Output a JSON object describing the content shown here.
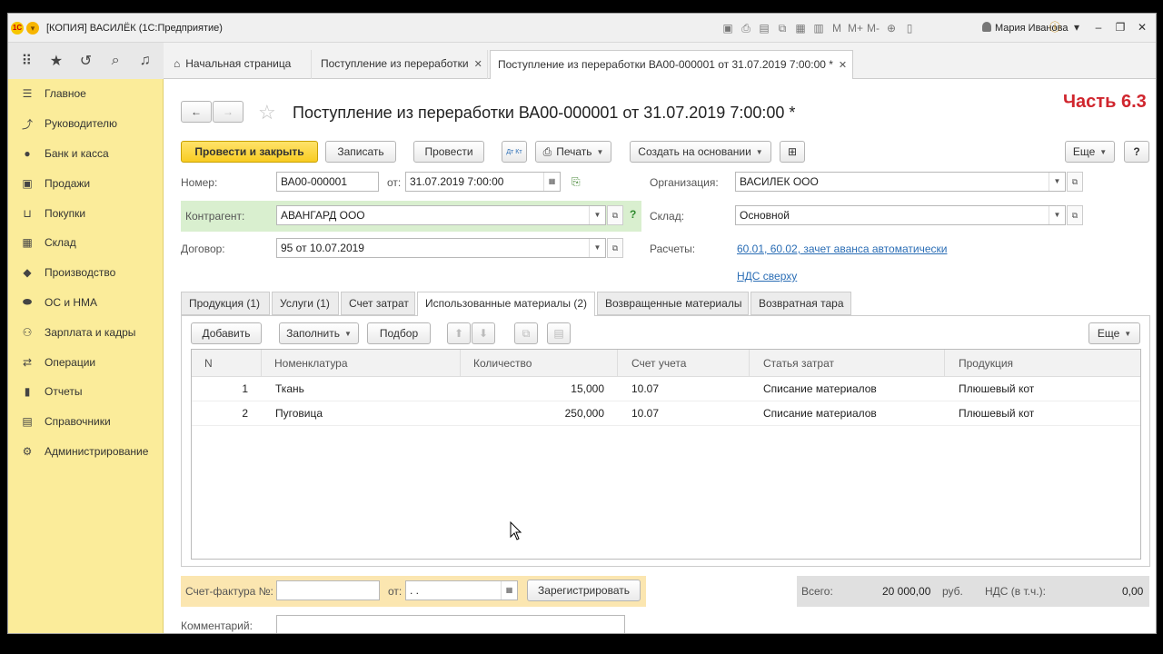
{
  "app": {
    "title": "[КОПИЯ] ВАСИЛЁК  (1С:Предприятие)",
    "user_name": "Мария Иванова",
    "part_label": "Часть 6.3"
  },
  "tabs": [
    {
      "label": "Начальная страница"
    },
    {
      "label": "Поступление из переработки"
    },
    {
      "label": "Поступление из переработки ВА00-000001 от 31.07.2019 7:00:00 *"
    }
  ],
  "sidebar": {
    "items": [
      {
        "label": "Главное",
        "icon": "menu-icon"
      },
      {
        "label": "Руководителю",
        "icon": "trend-icon"
      },
      {
        "label": "Банк и касса",
        "icon": "coin-icon"
      },
      {
        "label": "Продажи",
        "icon": "bag-icon"
      },
      {
        "label": "Покупки",
        "icon": "cart-icon"
      },
      {
        "label": "Склад",
        "icon": "warehouse-icon"
      },
      {
        "label": "Производство",
        "icon": "factory-icon"
      },
      {
        "label": "ОС и НМА",
        "icon": "assets-icon"
      },
      {
        "label": "Зарплата и кадры",
        "icon": "people-icon"
      },
      {
        "label": "Операции",
        "icon": "operations-icon"
      },
      {
        "label": "Отчеты",
        "icon": "report-icon"
      },
      {
        "label": "Справочники",
        "icon": "book-icon"
      },
      {
        "label": "Администрирование",
        "icon": "gear-icon"
      }
    ]
  },
  "document": {
    "title": "Поступление из переработки ВА00-000001 от 31.07.2019 7:00:00 *"
  },
  "toolbar": {
    "post_close": "Провести и закрыть",
    "save": "Записать",
    "post": "Провести",
    "dtkt": "Дт Кт",
    "print": "Печать",
    "create_based": "Создать на основании",
    "more": "Еще",
    "help": "?"
  },
  "form": {
    "number_label": "Номер:",
    "number_value": "ВА00-000001",
    "date_label": "от:",
    "date_value": "31.07.2019  7:00:00",
    "org_label": "Организация:",
    "org_value": "ВАСИЛЕК ООО",
    "contractor_label": "Контрагент:",
    "contractor_value": "АВАНГАРД ООО",
    "warehouse_label": "Склад:",
    "warehouse_value": "Основной",
    "contract_label": "Договор:",
    "contract_value": "95 от 10.07.2019",
    "settlements_label": "Расчеты:",
    "settlements_link": "60.01, 60.02, зачет аванса автоматически",
    "vat_link": "НДС сверху",
    "help_mark": "?"
  },
  "form_tabs": [
    {
      "label": "Продукция (1)"
    },
    {
      "label": "Услуги (1)"
    },
    {
      "label": "Счет затрат"
    },
    {
      "label": "Использованные материалы (2)"
    },
    {
      "label": "Возвращенные материалы"
    },
    {
      "label": "Возвратная тара"
    }
  ],
  "table_toolbar": {
    "add": "Добавить",
    "fill": "Заполнить",
    "select": "Подбор",
    "more": "Еще"
  },
  "table": {
    "columns": [
      "N",
      "Номенклатура",
      "Количество",
      "Счет учета",
      "Статья затрат",
      "Продукция"
    ],
    "rows": [
      {
        "n": "1",
        "item": "Ткань",
        "qty": "15,000",
        "account": "10.07",
        "cost": "Списание материалов",
        "product": "Плюшевый кот"
      },
      {
        "n": "2",
        "item": "Пуговица",
        "qty": "250,000",
        "account": "10.07",
        "cost": "Списание материалов",
        "product": "Плюшевый кот"
      }
    ]
  },
  "footer": {
    "invoice_label": "Счет-фактура №:",
    "invoice_value": "",
    "invoice_date_label": "от:",
    "invoice_date_value": " .  .",
    "register": "Зарегистрировать",
    "total_label": "Всего:",
    "total_value": "20 000,00",
    "currency": "руб.",
    "vat_label": "НДС (в т.ч.):",
    "vat_value": "0,00",
    "comment_label": "Комментарий:",
    "comment_value": ""
  }
}
